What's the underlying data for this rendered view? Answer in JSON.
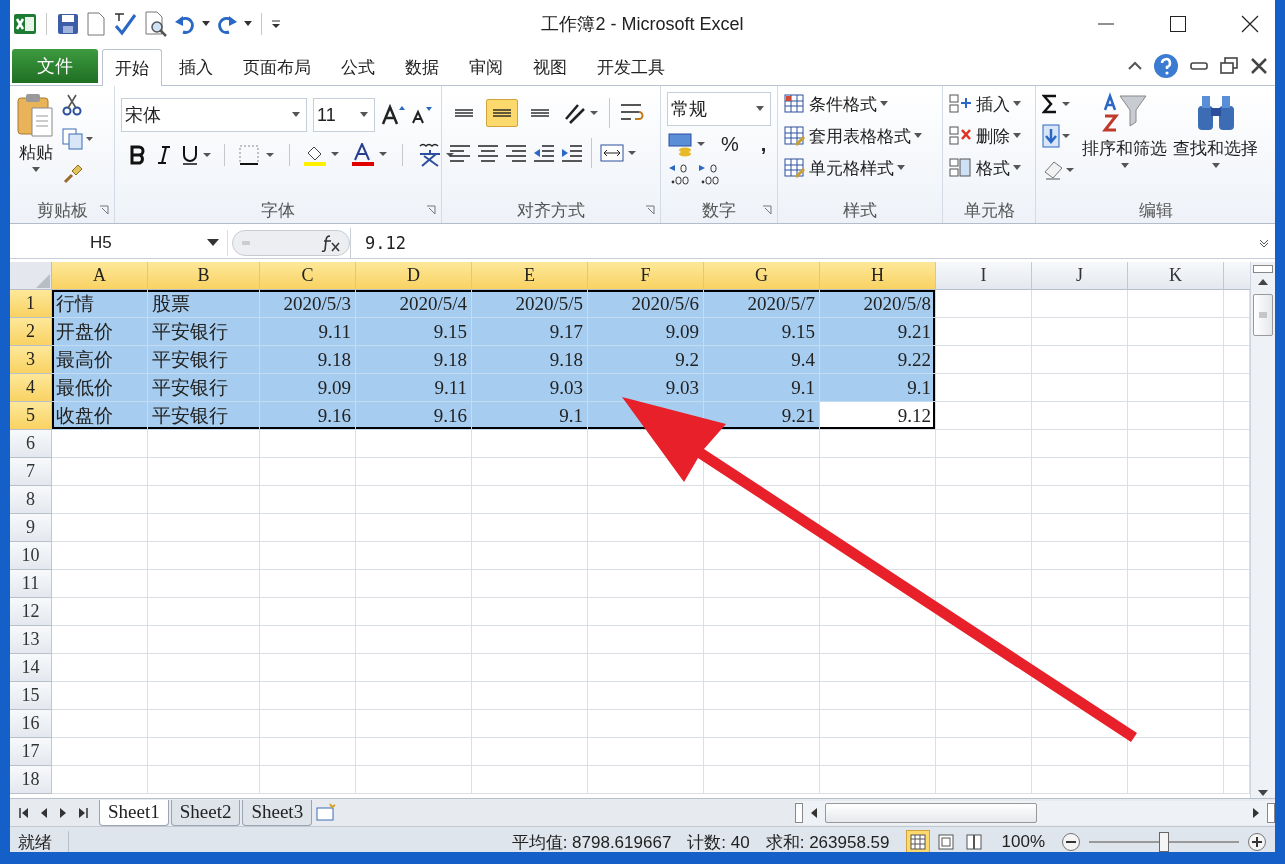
{
  "window": {
    "title": "工作簿2 - Microsoft Excel"
  },
  "tabs": [
    {
      "label": "文件",
      "kind": "file",
      "selected": false
    },
    {
      "label": "开始",
      "kind": "tab",
      "selected": true
    },
    {
      "label": "插入",
      "kind": "tab",
      "selected": false
    },
    {
      "label": "页面布局",
      "kind": "tab",
      "selected": false
    },
    {
      "label": "公式",
      "kind": "tab",
      "selected": false
    },
    {
      "label": "数据",
      "kind": "tab",
      "selected": false
    },
    {
      "label": "审阅",
      "kind": "tab",
      "selected": false
    },
    {
      "label": "视图",
      "kind": "tab",
      "selected": false
    },
    {
      "label": "开发工具",
      "kind": "tab",
      "selected": false
    }
  ],
  "ribbon": {
    "clipboard": {
      "label": "剪贴板",
      "paste": "粘贴"
    },
    "font": {
      "label": "字体",
      "font_name": "宋体",
      "font_size": "11"
    },
    "alignment": {
      "label": "对齐方式",
      "vertical_align": [
        {
          "selected": false
        },
        {
          "selected": true
        },
        {
          "selected": false
        }
      ]
    },
    "number": {
      "label": "数字",
      "format": "常规",
      "percent": "%",
      "comma": ","
    },
    "styles": {
      "label": "样式",
      "buttons": [
        "条件格式",
        "套用表格格式",
        "单元格样式"
      ]
    },
    "cells": {
      "label": "单元格",
      "buttons": [
        "插入",
        "删除",
        "格式"
      ]
    },
    "editing": {
      "label": "编辑",
      "buttons": [
        "排序和筛选",
        "查找和选择"
      ]
    }
  },
  "formula_bar": {
    "name_box": "H5",
    "formula": "9.12"
  },
  "columns": [
    {
      "label": "A",
      "selected": true
    },
    {
      "label": "B",
      "selected": true
    },
    {
      "label": "C",
      "selected": true
    },
    {
      "label": "D",
      "selected": true
    },
    {
      "label": "E",
      "selected": true
    },
    {
      "label": "F",
      "selected": true
    },
    {
      "label": "G",
      "selected": true
    },
    {
      "label": "H",
      "selected": true
    },
    {
      "label": "I",
      "selected": false
    },
    {
      "label": "J",
      "selected": false
    },
    {
      "label": "K",
      "selected": false
    }
  ],
  "rows": [
    {
      "header": "1",
      "selected": true,
      "cells": [
        {
          "text": "行情",
          "kind": "text",
          "active": false
        },
        {
          "text": "股票",
          "kind": "text",
          "active": false
        },
        {
          "text": "2020/5/3",
          "kind": "number",
          "active": false
        },
        {
          "text": "2020/5/4",
          "kind": "number",
          "active": false
        },
        {
          "text": "2020/5/5",
          "kind": "number",
          "active": false
        },
        {
          "text": "2020/5/6",
          "kind": "number",
          "active": false
        },
        {
          "text": "2020/5/7",
          "kind": "number",
          "active": false
        },
        {
          "text": "2020/5/8",
          "kind": "number",
          "active": false
        }
      ]
    },
    {
      "header": "2",
      "selected": true,
      "cells": [
        {
          "text": "开盘价",
          "kind": "text",
          "active": false
        },
        {
          "text": "平安银行",
          "kind": "text",
          "active": false
        },
        {
          "text": "9.11",
          "kind": "number",
          "active": false
        },
        {
          "text": "9.15",
          "kind": "number",
          "active": false
        },
        {
          "text": "9.17",
          "kind": "number",
          "active": false
        },
        {
          "text": "9.09",
          "kind": "number",
          "active": false
        },
        {
          "text": "9.15",
          "kind": "number",
          "active": false
        },
        {
          "text": "9.21",
          "kind": "number",
          "active": false
        }
      ]
    },
    {
      "header": "3",
      "selected": true,
      "cells": [
        {
          "text": "最高价",
          "kind": "text",
          "active": false
        },
        {
          "text": "平安银行",
          "kind": "text",
          "active": false
        },
        {
          "text": "9.18",
          "kind": "number",
          "active": false
        },
        {
          "text": "9.18",
          "kind": "number",
          "active": false
        },
        {
          "text": "9.18",
          "kind": "number",
          "active": false
        },
        {
          "text": "9.2",
          "kind": "number",
          "active": false
        },
        {
          "text": "9.4",
          "kind": "number",
          "active": false
        },
        {
          "text": "9.22",
          "kind": "number",
          "active": false
        }
      ]
    },
    {
      "header": "4",
      "selected": true,
      "cells": [
        {
          "text": "最低价",
          "kind": "text",
          "active": false
        },
        {
          "text": "平安银行",
          "kind": "text",
          "active": false
        },
        {
          "text": "9.09",
          "kind": "number",
          "active": false
        },
        {
          "text": "9.11",
          "kind": "number",
          "active": false
        },
        {
          "text": "9.03",
          "kind": "number",
          "active": false
        },
        {
          "text": "9.03",
          "kind": "number",
          "active": false
        },
        {
          "text": "9.1",
          "kind": "number",
          "active": false
        },
        {
          "text": "9.1",
          "kind": "number",
          "active": false
        }
      ]
    },
    {
      "header": "5",
      "selected": true,
      "cells": [
        {
          "text": "收盘价",
          "kind": "text",
          "active": false
        },
        {
          "text": "平安银行",
          "kind": "text",
          "active": false
        },
        {
          "text": "9.16",
          "kind": "number",
          "active": false
        },
        {
          "text": "9.16",
          "kind": "number",
          "active": false
        },
        {
          "text": "9.1",
          "kind": "number",
          "active": false
        },
        {
          "kind": "number",
          "active": false
        },
        {
          "text": "9.21",
          "kind": "number",
          "active": false
        },
        {
          "text": "9.12",
          "kind": "number",
          "active": true
        }
      ]
    },
    {
      "header": "6",
      "selected": false
    },
    {
      "header": "7",
      "selected": false
    },
    {
      "header": "8",
      "selected": false
    },
    {
      "header": "9",
      "selected": false
    },
    {
      "header": "10",
      "selected": false
    },
    {
      "header": "11",
      "selected": false
    },
    {
      "header": "12",
      "selected": false
    },
    {
      "header": "13",
      "selected": false
    },
    {
      "header": "14",
      "selected": false
    },
    {
      "header": "15",
      "selected": false
    },
    {
      "header": "16",
      "selected": false
    },
    {
      "header": "17",
      "selected": false
    },
    {
      "header": "18",
      "selected": false
    }
  ],
  "sheets": [
    {
      "label": "Sheet1",
      "selected": true
    },
    {
      "label": "Sheet2",
      "selected": false
    },
    {
      "label": "Sheet3",
      "selected": false
    }
  ],
  "status_bar": {
    "mode": "就绪",
    "average": "平均值: 8798.619667",
    "count": "计数: 40",
    "sum": "求和: 263958.59",
    "zoom": "100%",
    "zoom_level": {
      "level": 0.5
    },
    "views": [
      {
        "selected": true
      },
      {
        "selected": false
      },
      {
        "selected": false
      }
    ]
  },
  "annotation": {
    "kind": "arrow"
  }
}
